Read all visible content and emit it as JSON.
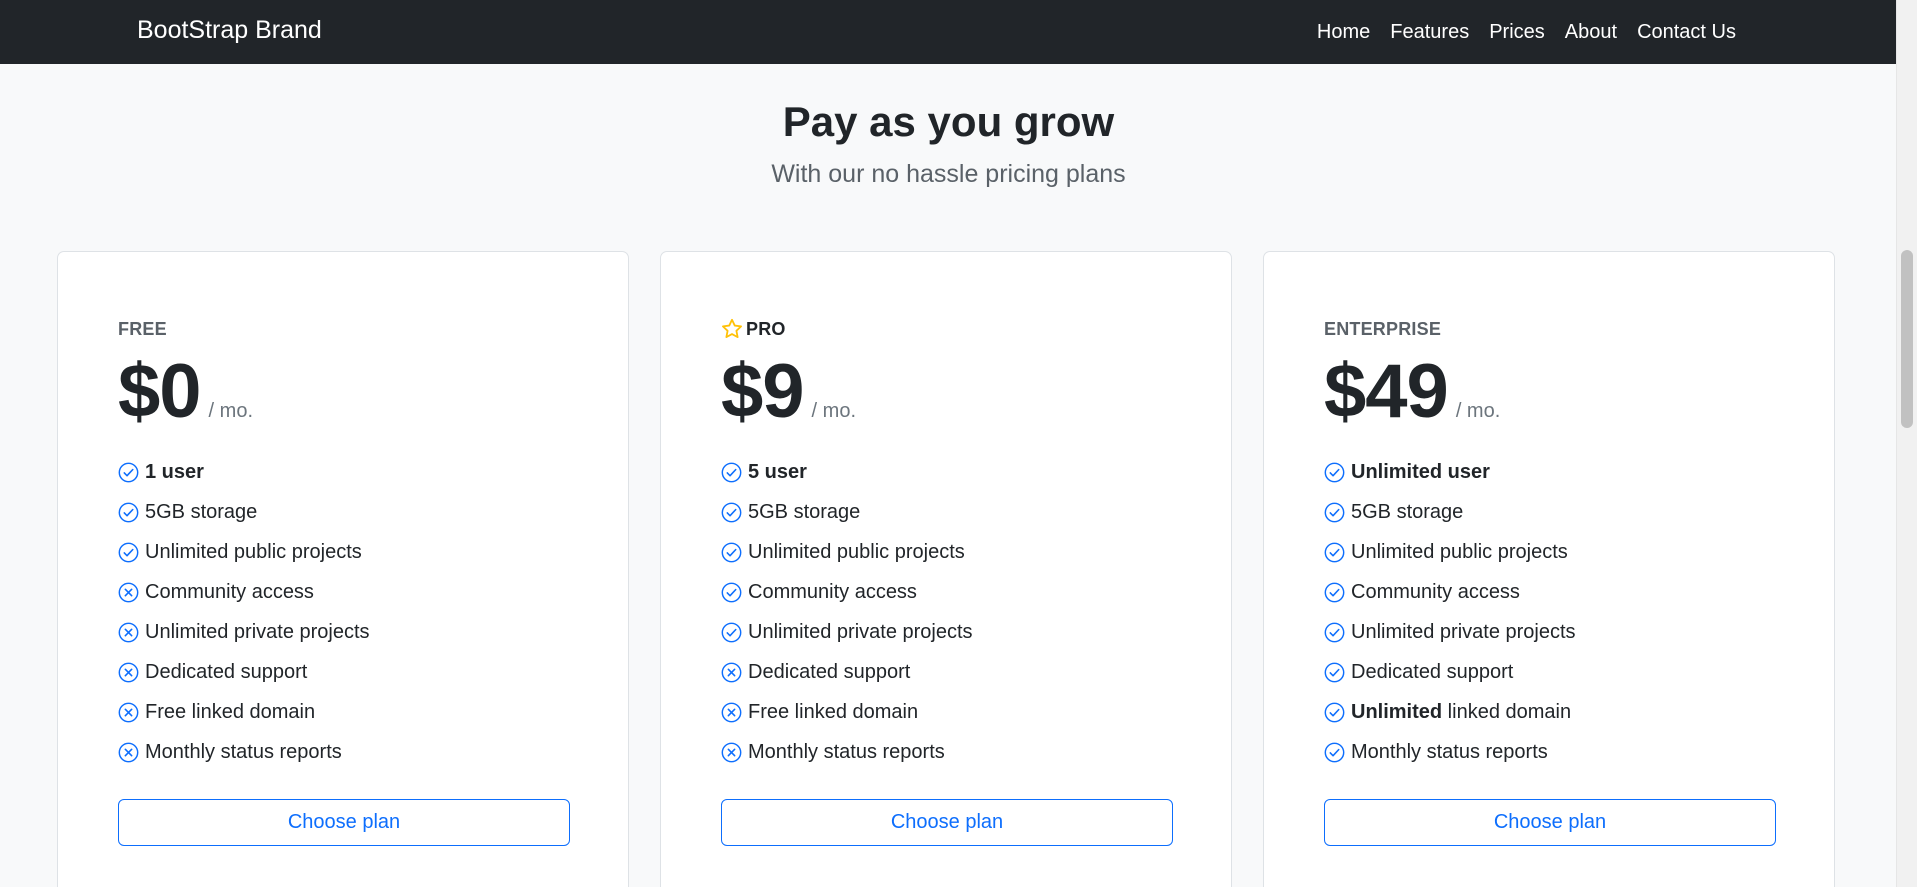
{
  "navbar": {
    "brand": "BootStrap Brand",
    "links": [
      "Home",
      "Features",
      "Prices",
      "About",
      "Contact Us"
    ]
  },
  "hero": {
    "title": "Pay as you grow",
    "subtitle": "With our no hassle pricing plans"
  },
  "colors": {
    "accent": "#0d6efd",
    "star": "#ffc107",
    "navbar_bg": "#212529"
  },
  "plans": [
    {
      "name": "FREE",
      "price": "$0",
      "period": "/ mo.",
      "button": "Choose plan",
      "features": [
        {
          "bold": "1 user",
          "text": "",
          "included": true,
          "icon": "check-circle-icon"
        },
        {
          "bold": "",
          "text": "5GB storage",
          "included": true,
          "icon": "check-circle-icon"
        },
        {
          "bold": "",
          "text": "Unlimited public projects",
          "included": true,
          "icon": "check-circle-icon"
        },
        {
          "bold": "",
          "text": "Community access",
          "included": false,
          "icon": "x-circle-icon"
        },
        {
          "bold": "",
          "text": "Unlimited private projects",
          "included": false,
          "icon": "x-circle-icon"
        },
        {
          "bold": "",
          "text": "Dedicated support",
          "included": false,
          "icon": "x-circle-icon"
        },
        {
          "bold": "",
          "text": "Free linked domain",
          "included": false,
          "icon": "x-circle-icon"
        },
        {
          "bold": "",
          "text": "Monthly status reports",
          "included": false,
          "icon": "x-circle-icon"
        }
      ]
    },
    {
      "name": "PRO",
      "icon": "star-icon",
      "price": "$9",
      "period": "/ mo.",
      "button": "Choose plan",
      "features": [
        {
          "bold": "5 user",
          "text": "",
          "included": true,
          "icon": "check-circle-icon"
        },
        {
          "bold": "",
          "text": "5GB storage",
          "included": true,
          "icon": "check-circle-icon"
        },
        {
          "bold": "",
          "text": "Unlimited public projects",
          "included": true,
          "icon": "check-circle-icon"
        },
        {
          "bold": "",
          "text": "Community access",
          "included": true,
          "icon": "check-circle-icon"
        },
        {
          "bold": "",
          "text": "Unlimited private projects",
          "included": true,
          "icon": "check-circle-icon"
        },
        {
          "bold": "",
          "text": "Dedicated support",
          "included": false,
          "icon": "x-circle-icon"
        },
        {
          "bold": "",
          "text": "Free linked domain",
          "included": false,
          "icon": "x-circle-icon"
        },
        {
          "bold": "",
          "text": "Monthly status reports",
          "included": false,
          "icon": "x-circle-icon"
        }
      ]
    },
    {
      "name": "ENTERPRISE",
      "price": "$49",
      "period": "/ mo.",
      "button": "Choose plan",
      "features": [
        {
          "bold": "Unlimited user",
          "text": "",
          "included": true,
          "icon": "check-circle-icon"
        },
        {
          "bold": "",
          "text": "5GB storage",
          "included": true,
          "icon": "check-circle-icon"
        },
        {
          "bold": "",
          "text": "Unlimited public projects",
          "included": true,
          "icon": "check-circle-icon"
        },
        {
          "bold": "",
          "text": "Community access",
          "included": true,
          "icon": "check-circle-icon"
        },
        {
          "bold": "",
          "text": "Unlimited private projects",
          "included": true,
          "icon": "check-circle-icon"
        },
        {
          "bold": "",
          "text": "Dedicated support",
          "included": true,
          "icon": "check-circle-icon"
        },
        {
          "bold": "Unlimited",
          "text": " linked domain",
          "included": true,
          "icon": "check-circle-icon"
        },
        {
          "bold": "",
          "text": "Monthly status reports",
          "included": true,
          "icon": "check-circle-icon"
        }
      ]
    }
  ]
}
